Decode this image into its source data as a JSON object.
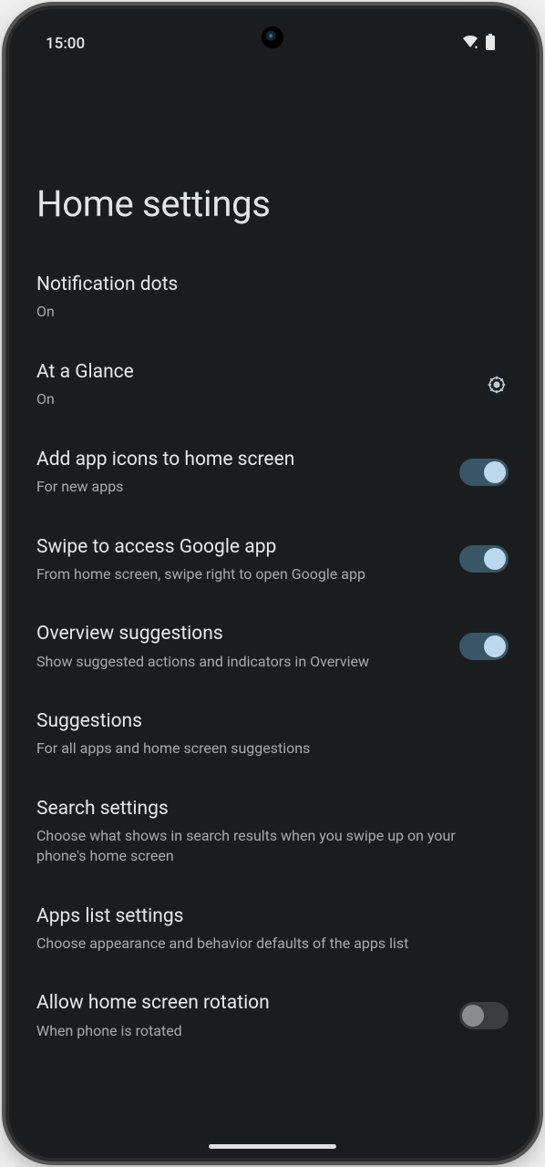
{
  "status": {
    "time": "15:00"
  },
  "page": {
    "title": "Home settings"
  },
  "items": [
    {
      "title": "Notification dots",
      "sub": "On",
      "type": "plain"
    },
    {
      "title": "At a Glance",
      "sub": "On",
      "type": "gear"
    },
    {
      "title": "Add app icons to home screen",
      "sub": "For new apps",
      "type": "toggle",
      "on": true
    },
    {
      "title": "Swipe to access Google app",
      "sub": "From home screen, swipe right to open Google app",
      "type": "toggle",
      "on": true
    },
    {
      "title": "Overview suggestions",
      "sub": "Show suggested actions and indicators in Overview",
      "type": "toggle",
      "on": true
    },
    {
      "title": "Suggestions",
      "sub": "For all apps and home screen suggestions",
      "type": "plain"
    },
    {
      "title": "Search settings",
      "sub": "Choose what shows in search results when you swipe up on your phone's home screen",
      "type": "plain"
    },
    {
      "title": "Apps list settings",
      "sub": "Choose appearance and behavior defaults of the apps list",
      "type": "plain"
    },
    {
      "title": "Allow home screen rotation",
      "sub": "When phone is rotated",
      "type": "toggle",
      "on": false
    }
  ]
}
